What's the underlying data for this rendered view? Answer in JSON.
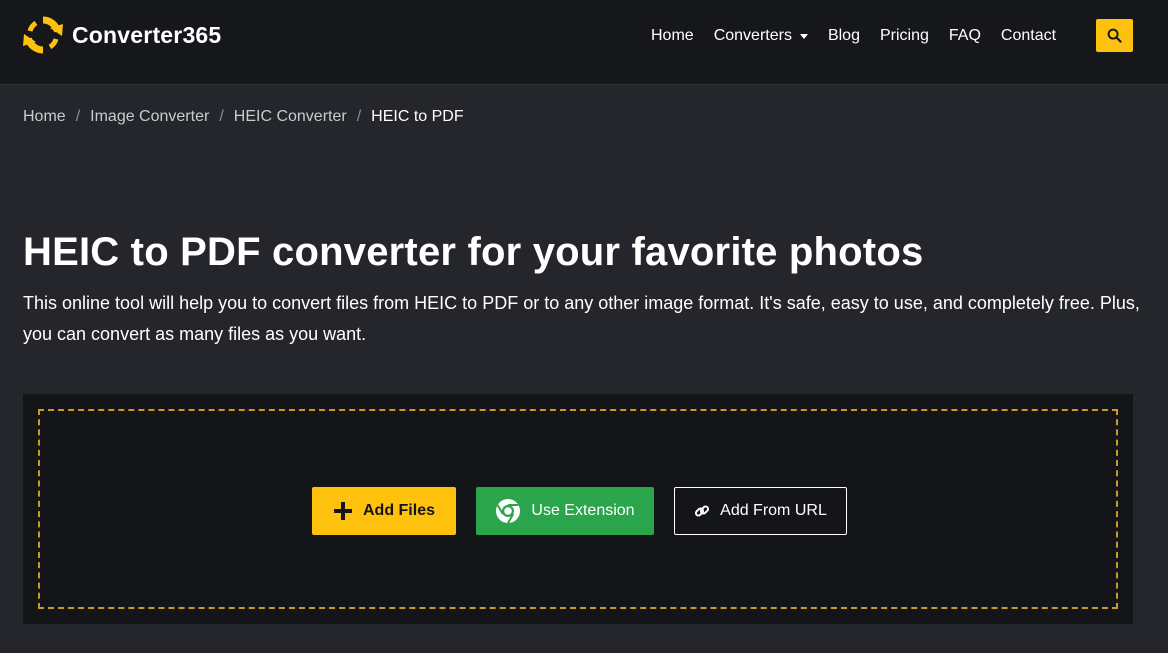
{
  "header": {
    "brand": "Converter365",
    "nav": [
      {
        "label": "Home"
      },
      {
        "label": "Converters",
        "has_dropdown": true
      },
      {
        "label": "Blog"
      },
      {
        "label": "Pricing"
      },
      {
        "label": "FAQ"
      },
      {
        "label": "Contact"
      }
    ],
    "search_icon": "search-icon"
  },
  "breadcrumb": {
    "items": [
      "Home",
      "Image Converter",
      "HEIC Converter"
    ],
    "current": "HEIC to PDF",
    "separator": "/"
  },
  "hero": {
    "title": "HEIC to PDF converter for your favorite photos",
    "description": "This online tool will help you to convert files from HEIC to PDF or to any other image format. It's safe, easy to use, and completely free. Plus, you can convert as many files as you want."
  },
  "upload": {
    "add_files": "Add Files",
    "use_extension": "Use Extension",
    "add_from_url": "Add From URL"
  },
  "colors": {
    "accent": "#fdc10e",
    "extension_green": "#2aa54b",
    "navbar_bg": "#16171a",
    "page_bg": "#24262b",
    "panel_bg": "#141518",
    "dropzone_border": "#c99a25"
  }
}
